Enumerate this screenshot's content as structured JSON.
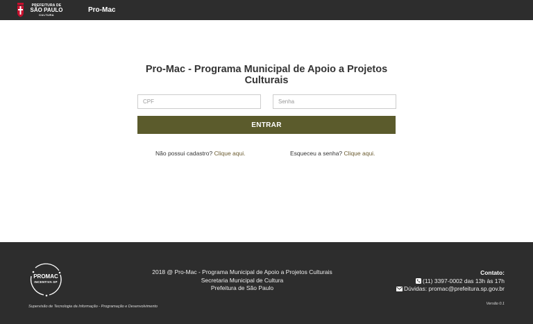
{
  "header": {
    "logo": {
      "line1": "PREFEITURA DE",
      "line2": "SÃO PAULO",
      "line3": "CULTURA",
      "icon": "sao-paulo-coat-of-arms"
    },
    "brand": "Pro-Mac",
    "colors": {
      "background": "#2d2d2d"
    }
  },
  "main": {
    "title": "Pro-Mac - Programa Municipal de Apoio a Projetos Culturais",
    "cpf": {
      "placeholder": "CPF",
      "value": ""
    },
    "password": {
      "placeholder": "Senha",
      "value": ""
    },
    "login_button": "ENTRAR",
    "register": {
      "text": "Não possui cadastro?",
      "link": "Clique aqui."
    },
    "forgot": {
      "text": "Esqueceu a senha?",
      "link": "Clique aqui."
    },
    "colors": {
      "button": "#5b5b2c",
      "link": "#6a5a2e"
    }
  },
  "footer": {
    "logo": {
      "name": "PROMAC",
      "sub": "INCENTIVA SP",
      "icon": "promac-ring-logo"
    },
    "line1": "2018 @ Pro-Mac - Programa Municipal de Apoio a Projetos Culturais",
    "line2": "Secretaria Municipal de Cultura",
    "line3": "Prefeitura de São Paulo",
    "contact_title": "Contato:",
    "phone": "(11) 3397-0002 das 13h às 17h",
    "email": "Dúvidas: promac@prefeitura.sp.gov.br",
    "credits": "Supervisão de Tecnologia da Informação - Programação e Desenvolvimento",
    "version": "Versão 0.1",
    "icons": {
      "phone": "phone-icon",
      "email": "envelope-icon"
    }
  }
}
